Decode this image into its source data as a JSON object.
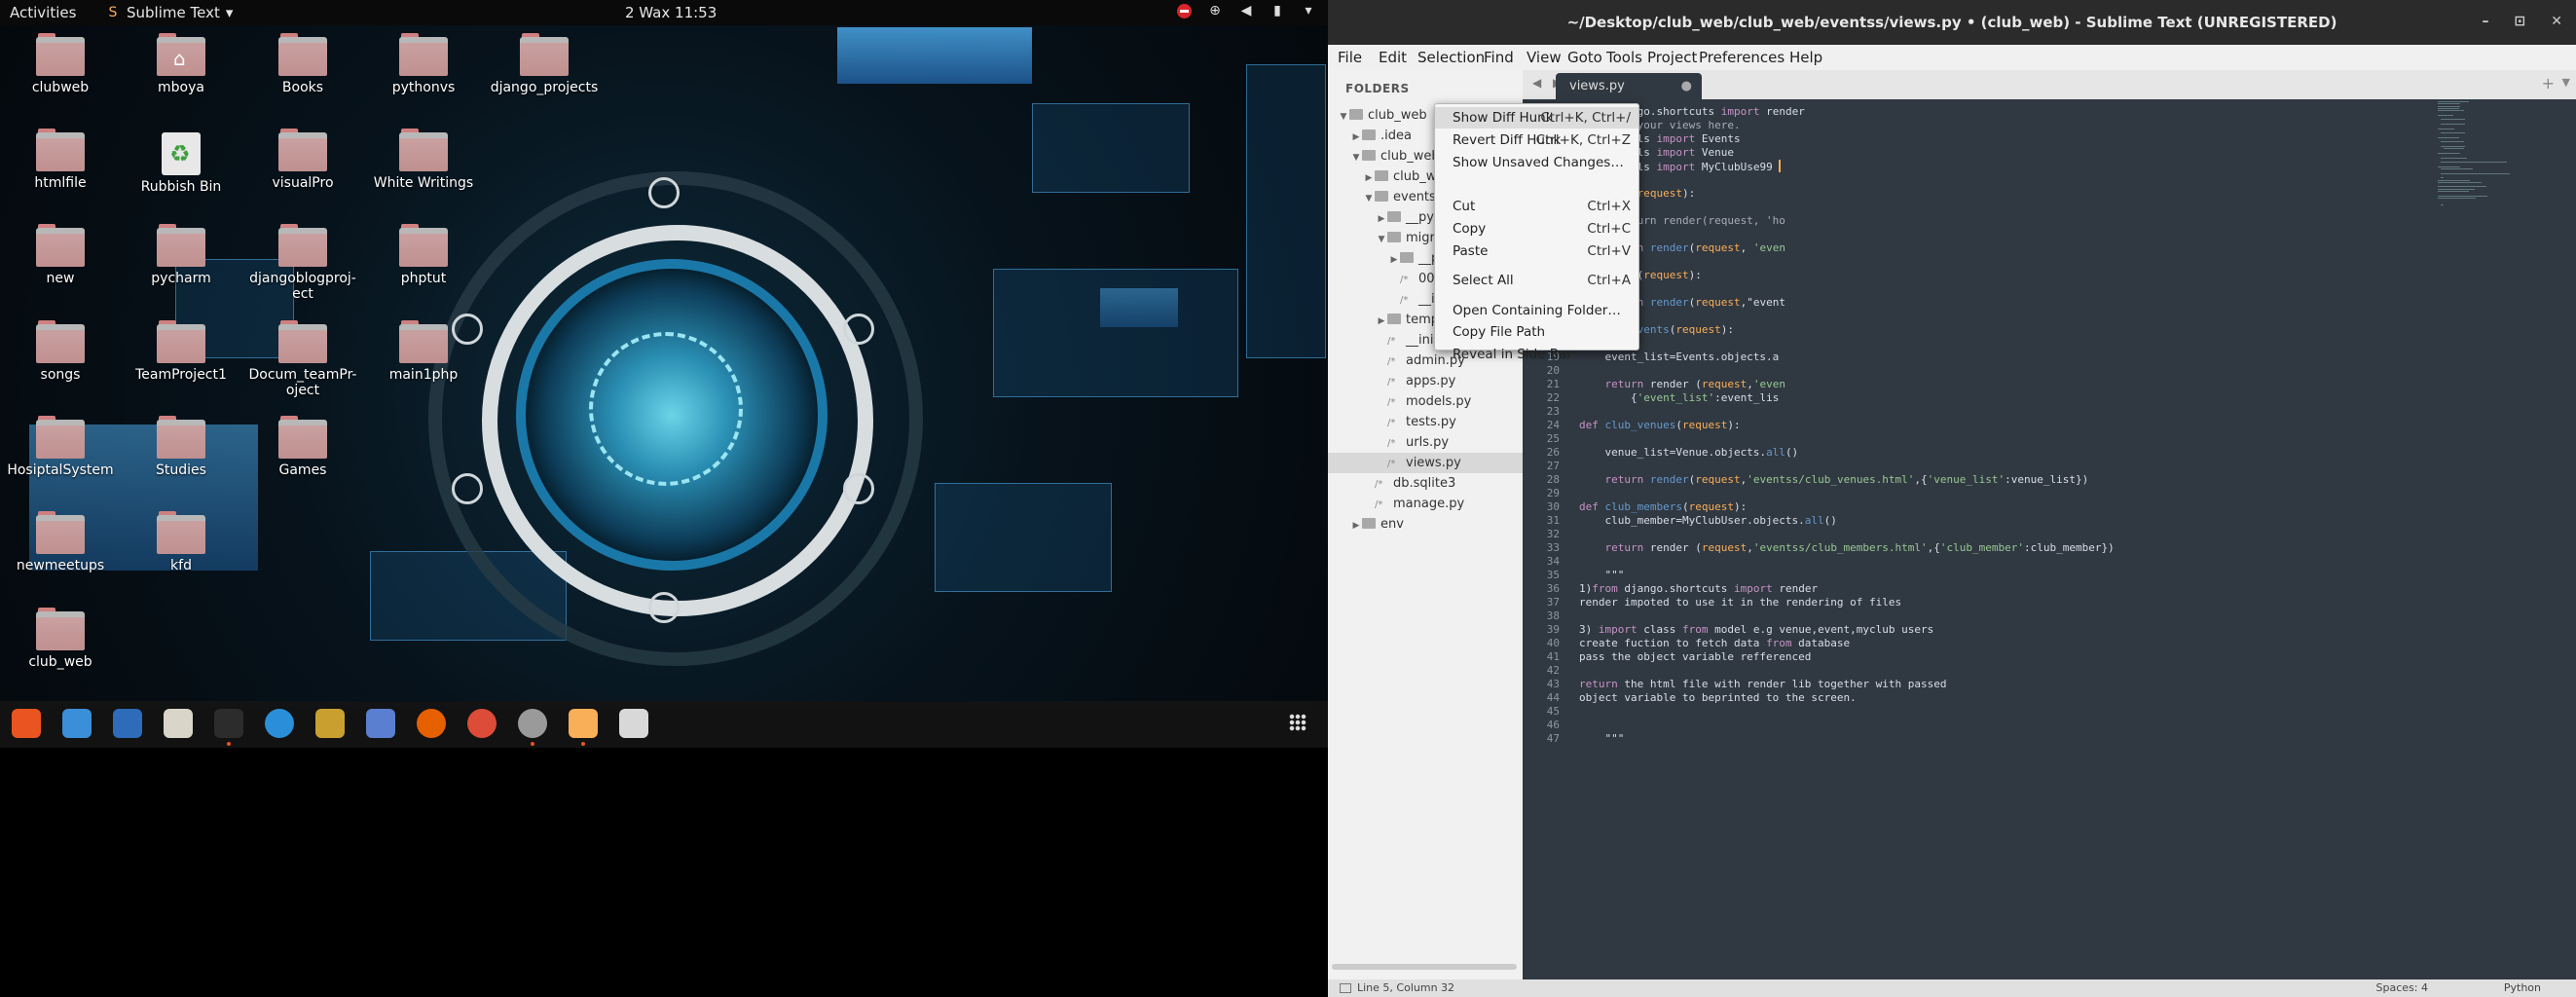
{
  "topbar": {
    "activities": "Activities",
    "app_name": "Sublime Text",
    "app_arrow": "▾",
    "clock": "2 Wax  11:53"
  },
  "desktop": {
    "icons": [
      {
        "label": "clubweb"
      },
      {
        "label": "mboya"
      },
      {
        "label": "Books"
      },
      {
        "label": "pythonvs"
      },
      {
        "label": "django_projects"
      },
      {
        "label": "htmlfile"
      },
      {
        "label": "Rubbish Bin"
      },
      {
        "label": "visualPro"
      },
      {
        "label": "White Writings"
      },
      {
        "label": "new"
      },
      {
        "label": "pycharm"
      },
      {
        "label": "djangoblogproj-ect"
      },
      {
        "label": "phptut"
      },
      {
        "label": "songs"
      },
      {
        "label": "TeamProject1"
      },
      {
        "label": "Docum_teamPr-oject"
      },
      {
        "label": "main1php"
      },
      {
        "label": "HosiptalSystem"
      },
      {
        "label": "Studies"
      },
      {
        "label": "Games"
      },
      {
        "label": "newmeetups"
      },
      {
        "label": "kfd"
      },
      {
        "label": "club_web"
      }
    ]
  },
  "dock": {
    "apps": [
      "ubuntu-software-icon",
      "text-editor-icon",
      "thunderbird-icon",
      "files-icon",
      "terminal-icon",
      "help-icon",
      "rhythmbox-icon",
      "screenshot-icon",
      "firefox-icon",
      "chrome-icon",
      "settings-icon",
      "sublime-text-icon",
      "libreoffice-calc-icon"
    ]
  },
  "window": {
    "title": "~/Desktop/club_web/club_web/eventss/views.py • (club_web) - Sublime Text (UNREGISTERED)",
    "minimize": "–",
    "maximize": "⊡",
    "close": "✕"
  },
  "menu": [
    "File",
    "Edit",
    "Selection",
    "Find",
    "View",
    "Goto",
    "Tools",
    "Project",
    "Preferences",
    "Help"
  ],
  "sidebar": {
    "heading": "FOLDERS",
    "tree": [
      {
        "label": "club_web",
        "arrow": "▼",
        "type": "folder"
      },
      {
        "label": ".idea",
        "arrow": "▶",
        "type": "folder"
      },
      {
        "label": "club_web",
        "arrow": "▼",
        "type": "folder"
      },
      {
        "label": "club_web",
        "arrow": "▶",
        "type": "folder"
      },
      {
        "label": "eventss",
        "arrow": "▼",
        "type": "folder"
      },
      {
        "label": "__pycache__",
        "arrow": "▶",
        "type": "folder"
      },
      {
        "label": "migrations",
        "arrow": "▼",
        "type": "folder"
      },
      {
        "label": "__pycache__",
        "arrow": "▶",
        "type": "folder"
      },
      {
        "label": "0001_initial.py",
        "arrow": "",
        "type": "file"
      },
      {
        "label": "__init__.py",
        "arrow": "",
        "type": "file"
      },
      {
        "label": "templates",
        "arrow": "▶",
        "type": "folder"
      },
      {
        "label": "__init__.py",
        "arrow": "",
        "type": "file"
      },
      {
        "label": "admin.py",
        "arrow": "",
        "type": "file"
      },
      {
        "label": "apps.py",
        "arrow": "",
        "type": "file"
      },
      {
        "label": "models.py",
        "arrow": "",
        "type": "file"
      },
      {
        "label": "tests.py",
        "arrow": "",
        "type": "file"
      },
      {
        "label": "urls.py",
        "arrow": "",
        "type": "file"
      },
      {
        "label": "views.py",
        "arrow": "",
        "type": "file",
        "selected": true
      },
      {
        "label": "db.sqlite3",
        "arrow": "",
        "type": "file"
      },
      {
        "label": "manage.py",
        "arrow": "",
        "type": "file"
      },
      {
        "label": "env",
        "arrow": "▶",
        "type": "folder"
      }
    ]
  },
  "tabs": {
    "nav": "◀ ▶",
    "active": "views.py",
    "close_dot": "●",
    "plus": "+",
    "dropdown": "▼"
  },
  "editor": {
    "current_line": 5,
    "lines": [
      "from django.shortcuts import render",
      "# Create your views here.",
      "from.models import Events",
      "from.models import Venue",
      "from.models import MyClubUse99 ",
      "",
      "def home(request):",
      "",
      "    # return render(request, 'ho",
      "",
      "    return render(request, 'even",
      "",
      "def neweb(request):",
      "",
      "    return render(request,\"event",
      "",
      "def all_events(request):",
      "",
      "    event_list=Events.objects.a",
      "",
      "    return render (request,'even",
      "        {'event_list':event_lis",
      "",
      "def club_venues(request):",
      "",
      "    venue_list=Venue.objects.all()",
      "",
      "    return render(request,'eventss/club_venues.html',{'venue_list':venue_list})",
      "",
      "def club_members(request):",
      "    club_member=MyClubUser.objects.all()",
      "",
      "    return render (request,'eventss/club_members.html',{'club_member':club_member})",
      "",
      "    \"\"\"",
      "1)from django.shortcuts import render",
      "render impoted to use it in the rendering of files",
      "",
      "3) import class from model e.g venue,event,myclub users",
      "create fuction to fetch data from database",
      "pass the object variable refferenced",
      "",
      "return the html file with render lib together with passed",
      "object variable to beprinted to the screen.",
      "",
      "",
      "    \"\"\""
    ]
  },
  "context_menu": [
    {
      "label": "Show Diff Hunk",
      "shortcut": "Ctrl+K, Ctrl+/"
    },
    {
      "label": "Revert Diff Hunk",
      "shortcut": "Ctrl+K, Ctrl+Z"
    },
    {
      "label": "Show Unsaved Changes…",
      "shortcut": ""
    },
    {
      "label": "Cut",
      "shortcut": "Ctrl+X"
    },
    {
      "label": "Copy",
      "shortcut": "Ctrl+C"
    },
    {
      "label": "Paste",
      "shortcut": "Ctrl+V"
    },
    {
      "label": "Select All",
      "shortcut": "Ctrl+A"
    },
    {
      "label": "Open Containing Folder…",
      "shortcut": ""
    },
    {
      "label": "Copy File Path",
      "shortcut": ""
    },
    {
      "label": "Reveal in Side Bar",
      "shortcut": ""
    }
  ],
  "status": {
    "position": "Line 5, Column 32",
    "spaces": "Spaces: 4",
    "syntax": "Python"
  },
  "colors": {
    "editor_bg": "#303841",
    "accent_orange": "#f9ae58",
    "keyword": "#c594c5",
    "function": "#6699cc",
    "string": "#99c794",
    "dock_dot": "#e95420"
  }
}
